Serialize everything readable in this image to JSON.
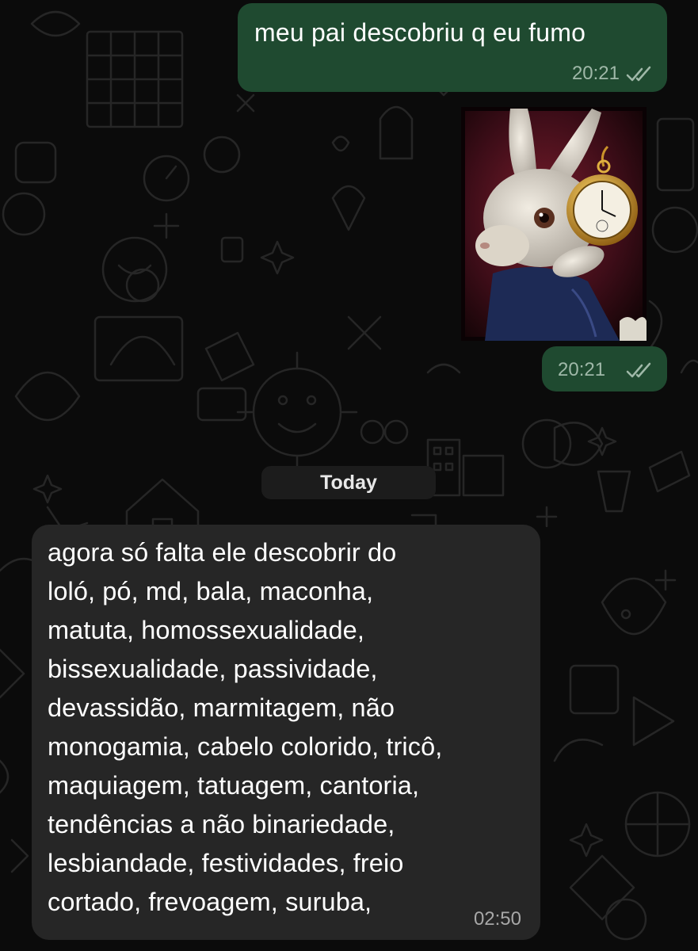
{
  "messages": {
    "first": {
      "text": "meu pai descobriu q eu fumo",
      "time": "20:21",
      "status": "read"
    },
    "image": {
      "description_icon": "white-rabbit-pocket-watch-image",
      "time": "20:21",
      "status": "read"
    }
  },
  "date_separator": "Today",
  "incoming": {
    "lines": [
      "agora só falta ele descobrir do",
      "loló, pó, md, bala, maconha,",
      "matuta, homossexualidade,",
      "bissexualidade, passividade,",
      "devassidão, marmitagem, não",
      "monogamia, cabelo colorido, tricô,",
      "maquiagem, tatuagem, cantoria,",
      "tendências a não binariedade,",
      "lesbiandade, festividades, freio",
      "cortado, frevoagem, suruba,"
    ],
    "time": "02:50"
  },
  "colors": {
    "outgoing_bubble": "#1f4a30",
    "incoming_bubble": "#262626",
    "background": "#0b0b0b",
    "read_ticks": "#9fb8a8"
  }
}
